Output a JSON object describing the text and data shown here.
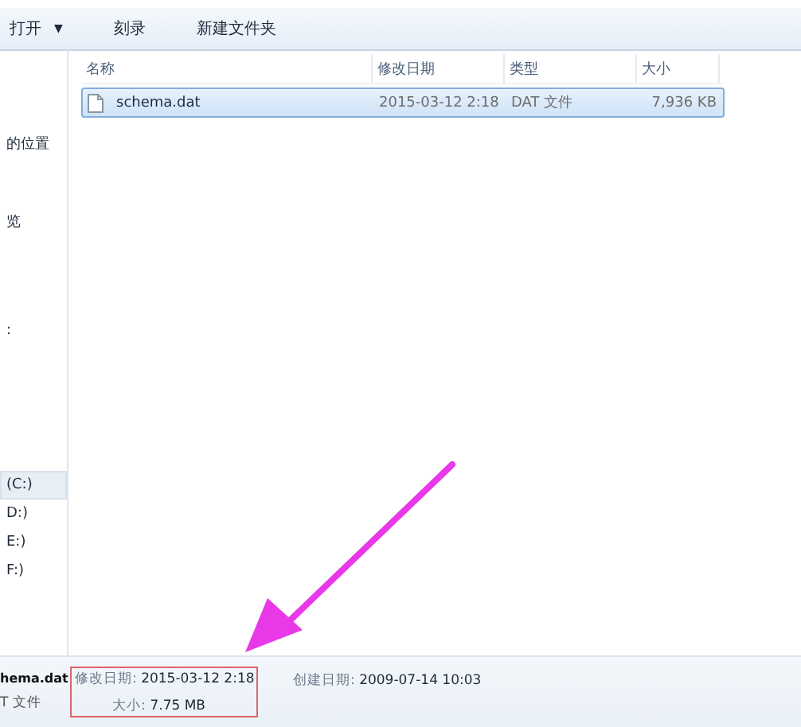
{
  "toolbar": {
    "buttons": [
      {
        "label": "打开",
        "kind": "dropdown",
        "caret": "▼"
      },
      {
        "label": "刻录",
        "kind": "plain"
      },
      {
        "label": "新建文件夹",
        "kind": "plain"
      }
    ]
  },
  "sidebar": {
    "groups": [
      {
        "items": [
          {
            "label": "的位置",
            "selected": false
          }
        ]
      },
      {
        "items": [
          {
            "label": "览",
            "selected": false
          }
        ]
      },
      {
        "items": [
          {
            "label": ":",
            "selected": false
          }
        ]
      },
      {
        "items": [
          {
            "label": "(C:)",
            "selected": true
          },
          {
            "label": "D:)",
            "selected": false
          },
          {
            "label": "E:)",
            "selected": false
          },
          {
            "label": "F:)",
            "selected": false
          }
        ]
      }
    ]
  },
  "table": {
    "columns": [
      "名称",
      "修改日期",
      "类型",
      "大小"
    ],
    "rows": [
      {
        "name": "schema.dat",
        "modified": "2015-03-12 2:18",
        "type": "DAT 文件",
        "size": "7,936 KB",
        "selected": true
      }
    ]
  },
  "details": {
    "name": "hema.dat",
    "type": "T 文件",
    "fields": [
      {
        "label": "修改日期:",
        "value": "2015-03-12 2:18"
      },
      {
        "label": "大小:",
        "value": "7.75 MB"
      },
      {
        "label": "创建日期:",
        "value": "2009-07-14 10:03"
      }
    ]
  }
}
